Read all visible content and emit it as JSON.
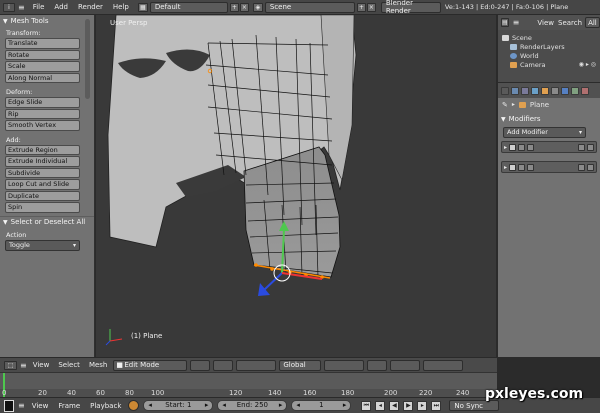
{
  "top": {
    "menus": [
      "File",
      "Add",
      "Render",
      "Help"
    ],
    "layout": "Default",
    "scene": "Scene",
    "engine": "Blender Render",
    "stats": "Ve:1-143 | Ed:0-247 | Fa:0-106 | Plane"
  },
  "toolshelf": {
    "title": "Mesh Tools",
    "transform_label": "Transform:",
    "transform": [
      "Translate",
      "Rotate",
      "Scale",
      "Along Normal"
    ],
    "deform_label": "Deform:",
    "deform": [
      "Edge Slide",
      "Rip",
      "Smooth Vertex"
    ],
    "add_label": "Add:",
    "add": [
      "Extrude Region",
      "Extrude Individual",
      "Subdivide",
      "Loop Cut and Slide",
      "Duplicate",
      "Spin"
    ],
    "operator_title": "Select or Deselect All",
    "action_label": "Action",
    "action_value": "Toggle"
  },
  "viewport": {
    "view_name": "User Persp",
    "object_name": "(1) Plane"
  },
  "outliner": {
    "view": "View",
    "search": "Search",
    "all": "All",
    "items": [
      "Scene",
      "RenderLayers",
      "World",
      "Camera"
    ]
  },
  "properties": {
    "object": "Plane",
    "modifiers_title": "Modifiers",
    "add_modifier": "Add Modifier"
  },
  "vp_header": {
    "menus": [
      "View",
      "Select",
      "Mesh"
    ],
    "mode": "Edit Mode",
    "orientation": "Global"
  },
  "timeline": {
    "ticks": [
      "0",
      "20",
      "40",
      "60",
      "80",
      "100",
      "120",
      "140",
      "160",
      "180",
      "200",
      "220",
      "240"
    ]
  },
  "footer": {
    "menus": [
      "View",
      "Frame",
      "Playback"
    ],
    "start": "Start: 1",
    "end": "End: 250",
    "current": "1",
    "sync": "No Sync"
  },
  "watermark": "pxleyes.com"
}
